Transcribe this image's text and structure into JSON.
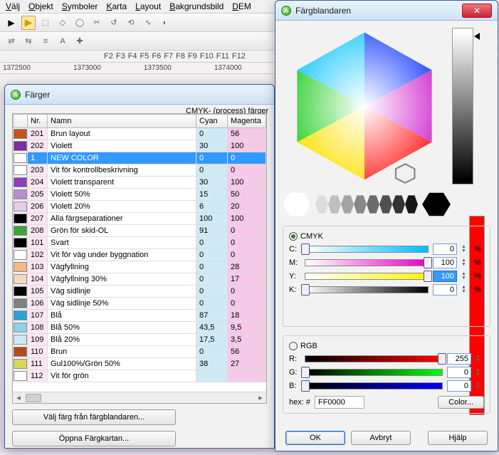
{
  "menu": {
    "items": [
      "Välj",
      "Objekt",
      "Symboler",
      "Karta",
      "Layout",
      "Bakgrundsbild",
      "DEM"
    ]
  },
  "fkeys": [
    "F2",
    "F3",
    "F4",
    "F5",
    "F6",
    "F7",
    "F8",
    "F9",
    "F10",
    "F11",
    "F12"
  ],
  "ruler": [
    "1372500",
    "1373000",
    "1373500",
    "1374000"
  ],
  "colors_dialog": {
    "title": "Färger",
    "group_label": "CMYK- (process) färger",
    "headers": {
      "nr": "Nr.",
      "name": "Namn",
      "cyan": "Cyan",
      "magenta": "Magenta"
    },
    "rows": [
      {
        "swatch": "#c4531f",
        "nr": "201",
        "name": "Brun layout",
        "cyan": "0",
        "mag": "56"
      },
      {
        "swatch": "#7b2fa0",
        "nr": "202",
        "name": "Violett",
        "cyan": "30",
        "mag": "100"
      },
      {
        "swatch": "#ffffff",
        "nr": "1",
        "name": "NEW COLOR",
        "cyan": "0",
        "mag": "0",
        "sel": true
      },
      {
        "swatch": "#ffffff",
        "nr": "203",
        "name": "Vit för kontrollbeskrivning",
        "cyan": "0",
        "mag": "0"
      },
      {
        "swatch": "#8b3fbb",
        "nr": "204",
        "name": "Violett transparent",
        "cyan": "30",
        "mag": "100"
      },
      {
        "swatch": "#b98fc9",
        "nr": "205",
        "name": "Violett 50%",
        "cyan": "15",
        "mag": "50"
      },
      {
        "swatch": "#e6cde9",
        "nr": "206",
        "name": "Violett 20%",
        "cyan": "6",
        "mag": "20"
      },
      {
        "swatch": "#000000",
        "nr": "207",
        "name": "Alla färgseparationer",
        "cyan": "100",
        "mag": "100"
      },
      {
        "swatch": "#3aa53a",
        "nr": "208",
        "name": "Grön för skid-OL",
        "cyan": "91",
        "mag": "0"
      },
      {
        "swatch": "#000000",
        "nr": "101",
        "name": "Svart",
        "cyan": "0",
        "mag": "0"
      },
      {
        "swatch": "#ffffff",
        "nr": "102",
        "name": "Vit för väg under byggnation",
        "cyan": "0",
        "mag": "0"
      },
      {
        "swatch": "#f2b98b",
        "nr": "103",
        "name": "Vägfyllning",
        "cyan": "0",
        "mag": "28"
      },
      {
        "swatch": "#f6d9c2",
        "nr": "104",
        "name": "Vägfyllning 30%",
        "cyan": "0",
        "mag": "17"
      },
      {
        "swatch": "#000000",
        "nr": "105",
        "name": "Väg sidlinje",
        "cyan": "0",
        "mag": "0"
      },
      {
        "swatch": "#808080",
        "nr": "106",
        "name": "Väg sidlinje 50%",
        "cyan": "0",
        "mag": "0"
      },
      {
        "swatch": "#2aa4d8",
        "nr": "107",
        "name": "Blå",
        "cyan": "87",
        "mag": "18"
      },
      {
        "swatch": "#8fd0eb",
        "nr": "108",
        "name": "Blå 50%",
        "cyan": "43,5",
        "mag": "9,5"
      },
      {
        "swatch": "#cfeaf5",
        "nr": "109",
        "name": "Blå 20%",
        "cyan": "17,5",
        "mag": "3,5"
      },
      {
        "swatch": "#b14b1f",
        "nr": "110",
        "name": "Brun",
        "cyan": "0",
        "mag": "56"
      },
      {
        "swatch": "#d8d85a",
        "nr": "111",
        "name": "Gul100%/Grön 50%",
        "cyan": "38",
        "mag": "27"
      },
      {
        "swatch": "#ffffff",
        "nr": "112",
        "name": "Vit för grön",
        "cyan": "",
        "mag": ""
      }
    ],
    "btn_pick": "Välj färg från färgblandaren...",
    "btn_map": "Öppna Färgkartan..."
  },
  "mixer_dialog": {
    "title": "Färgblandaren",
    "cmyk_label": "CMYK",
    "rgb_label": "RGB",
    "channels_cmyk": {
      "C": {
        "label": "C:",
        "val": "0",
        "pos": 0,
        "grad": "linear-gradient(to right,#ffffff,#00bfff)"
      },
      "M": {
        "label": "M:",
        "val": "100",
        "pos": 100,
        "grad": "linear-gradient(to right,#ffffff,#e700c8)"
      },
      "Y": {
        "label": "Y:",
        "val": "100",
        "pos": 100,
        "grad": "linear-gradient(to right,#ffffff,#fff200)",
        "sel": true
      },
      "K": {
        "label": "K:",
        "val": "0",
        "pos": 0,
        "grad": "linear-gradient(to right,#ffffff,#000000)"
      }
    },
    "channels_rgb": {
      "R": {
        "label": "R:",
        "val": "255",
        "pos": 100,
        "grad": "linear-gradient(to right,#000000,#ff0000)"
      },
      "G": {
        "label": "G:",
        "val": "0",
        "pos": 0,
        "grad": "linear-gradient(to right,#000000,#00ff00)"
      },
      "B": {
        "label": "B:",
        "val": "0",
        "pos": 0,
        "grad": "linear-gradient(to right,#000000,#0000ff)"
      }
    },
    "hex_label": "hex:  #",
    "hex_value": "FF0000",
    "color_btn": "Color...",
    "ok": "OK",
    "cancel": "Avbryt",
    "help": "Hjälp",
    "pct": "%"
  }
}
